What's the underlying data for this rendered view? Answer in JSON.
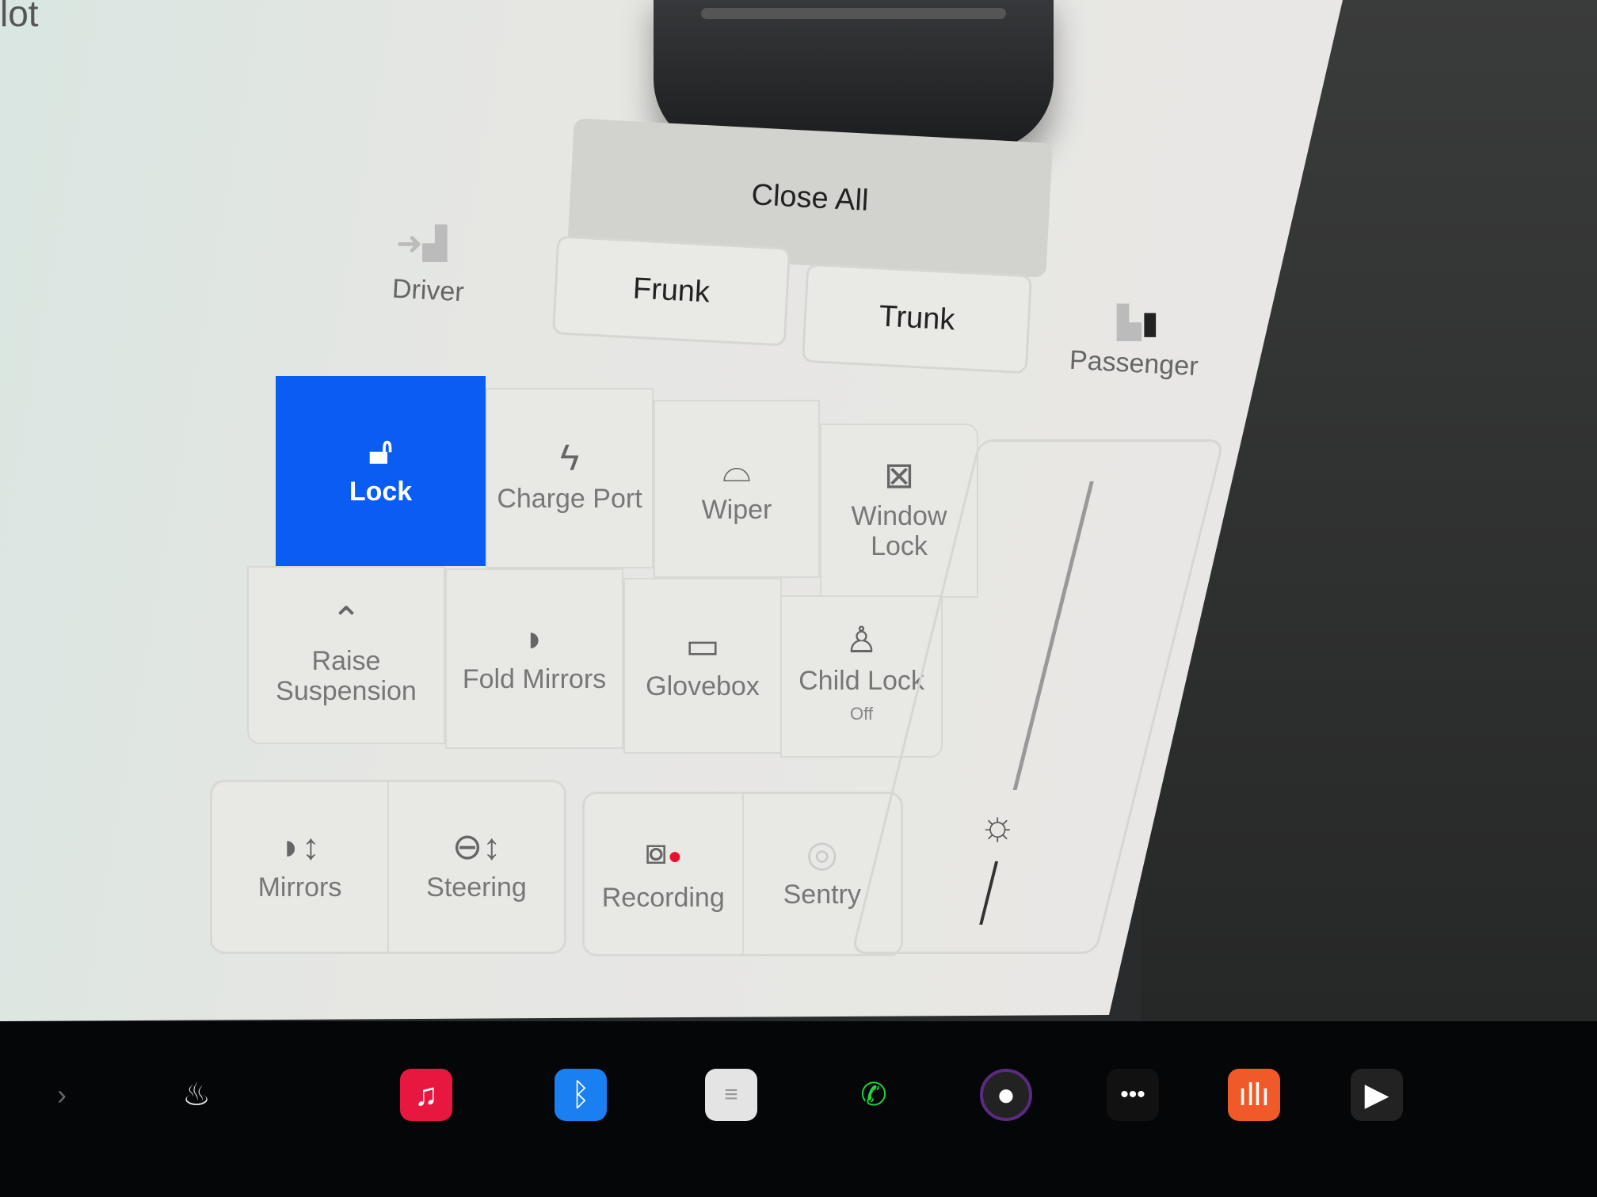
{
  "header": {
    "partial_title": "lot"
  },
  "closures": {
    "close_all": "Close All",
    "driver": "Driver",
    "passenger": "Passenger",
    "frunk": "Frunk",
    "trunk": "Trunk"
  },
  "controls": [
    {
      "label": "Lock",
      "icon": "unlock-icon",
      "active": true
    },
    {
      "label": "Charge Port",
      "icon": "lightning-icon"
    },
    {
      "label": "Wiper",
      "icon": "wiper-icon"
    },
    {
      "label": "Window Lock",
      "icon": "window-lock-icon"
    },
    {
      "label": "Raise Suspension",
      "icon": "suspension-icon"
    },
    {
      "label": "Fold Mirrors",
      "icon": "mirror-icon"
    },
    {
      "label": "Glovebox",
      "icon": "glovebox-icon"
    },
    {
      "label": "Child Lock",
      "sub": "Off",
      "icon": "child-lock-icon"
    }
  ],
  "adjust": [
    {
      "label": "Mirrors",
      "icon": "mirror-adjust-icon"
    },
    {
      "label": "Steering",
      "icon": "steering-adjust-icon"
    }
  ],
  "camera": [
    {
      "label": "Recording",
      "icon": "dashcam-icon",
      "status_color": "#e8112d"
    },
    {
      "label": "Sentry",
      "icon": "sentry-icon"
    }
  ],
  "accent": "#0b5cf2",
  "dock": [
    "chevron-right-icon",
    "seat-heater-icon",
    "music-icon",
    "bluetooth-icon",
    "notes-icon",
    "phone-icon",
    "camera-icon",
    "more-icon",
    "voice-memo-icon",
    "media-player-icon"
  ]
}
